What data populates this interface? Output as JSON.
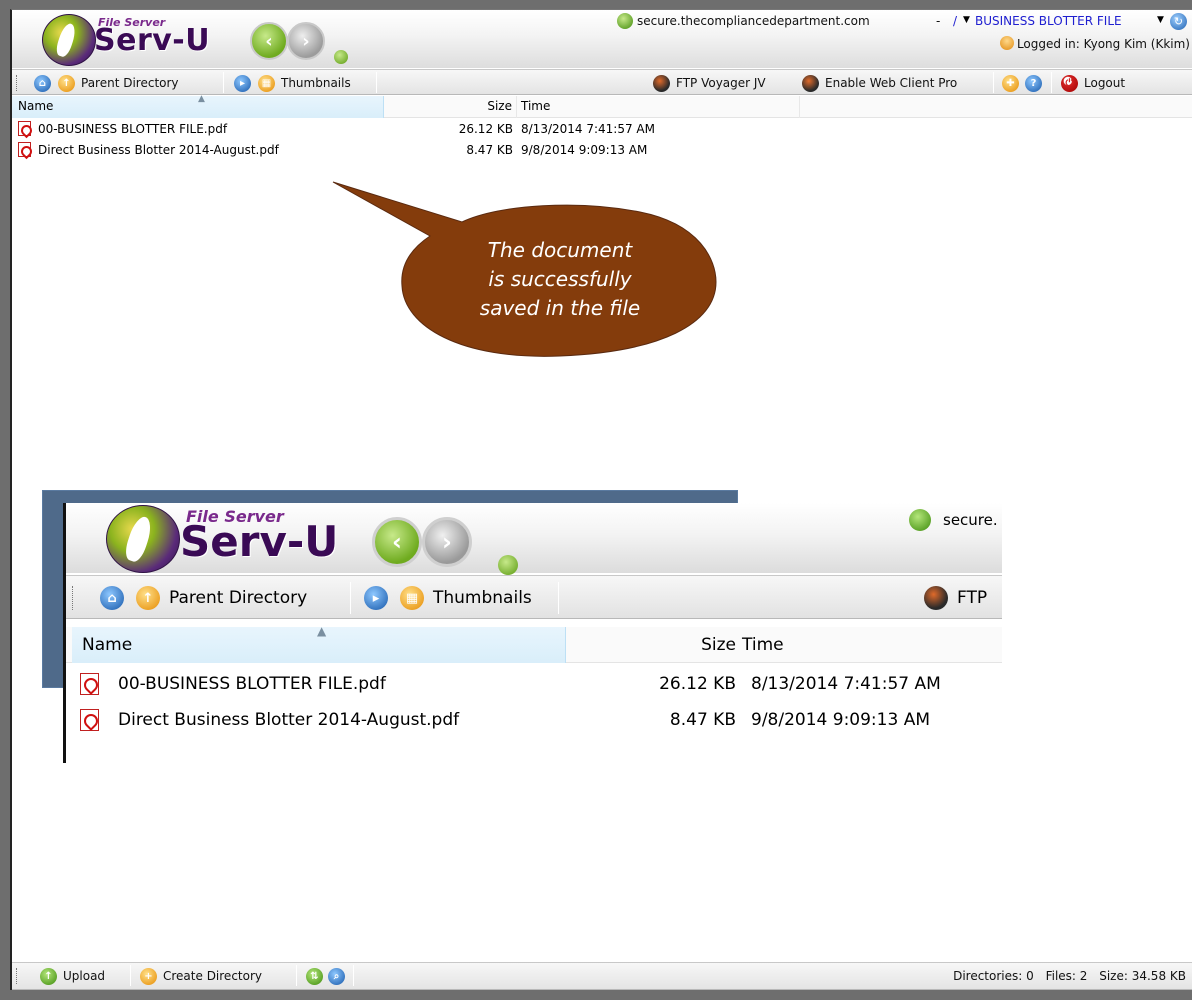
{
  "header": {
    "logo_small": "File Server",
    "logo_big": "Serv-U",
    "host": "secure.thecompliancedepartment.com",
    "path_sep": "-",
    "path_root": "/",
    "path_folder": "BUSINESS BLOTTER FILE",
    "logged_in": "Logged in: Kyong Kim (Kkim)"
  },
  "toolbar": {
    "parent_directory": "Parent Directory",
    "thumbnails": "Thumbnails",
    "ftp_voyager": "FTP Voyager JV",
    "enable_web_client": "Enable Web Client Pro",
    "logout": "Logout"
  },
  "list": {
    "columns": {
      "name": "Name",
      "size": "Size",
      "time": "Time"
    },
    "files": [
      {
        "name": "00-BUSINESS BLOTTER FILE.pdf",
        "size": "26.12 KB",
        "time": "8/13/2014 7:41:57 AM"
      },
      {
        "name": "Direct Business Blotter 2014-August.pdf",
        "size": "8.47 KB",
        "time": "9/8/2014 9:09:13 AM"
      }
    ]
  },
  "callout": {
    "line1": "The document",
    "line2": "is successfully",
    "line3": "saved in the file"
  },
  "inset": {
    "host_partial": "secure.",
    "ftp_partial": "FTP"
  },
  "bottom_toolbar": {
    "upload": "Upload",
    "create_directory": "Create Directory"
  },
  "status": {
    "directories": "Directories: 0",
    "files": "Files: 2",
    "size": "Size: 34.58 KB"
  },
  "colors": {
    "callout_fill": "#843c0c",
    "link_blue": "#2020d0",
    "header_accent": "#3a0a55"
  }
}
